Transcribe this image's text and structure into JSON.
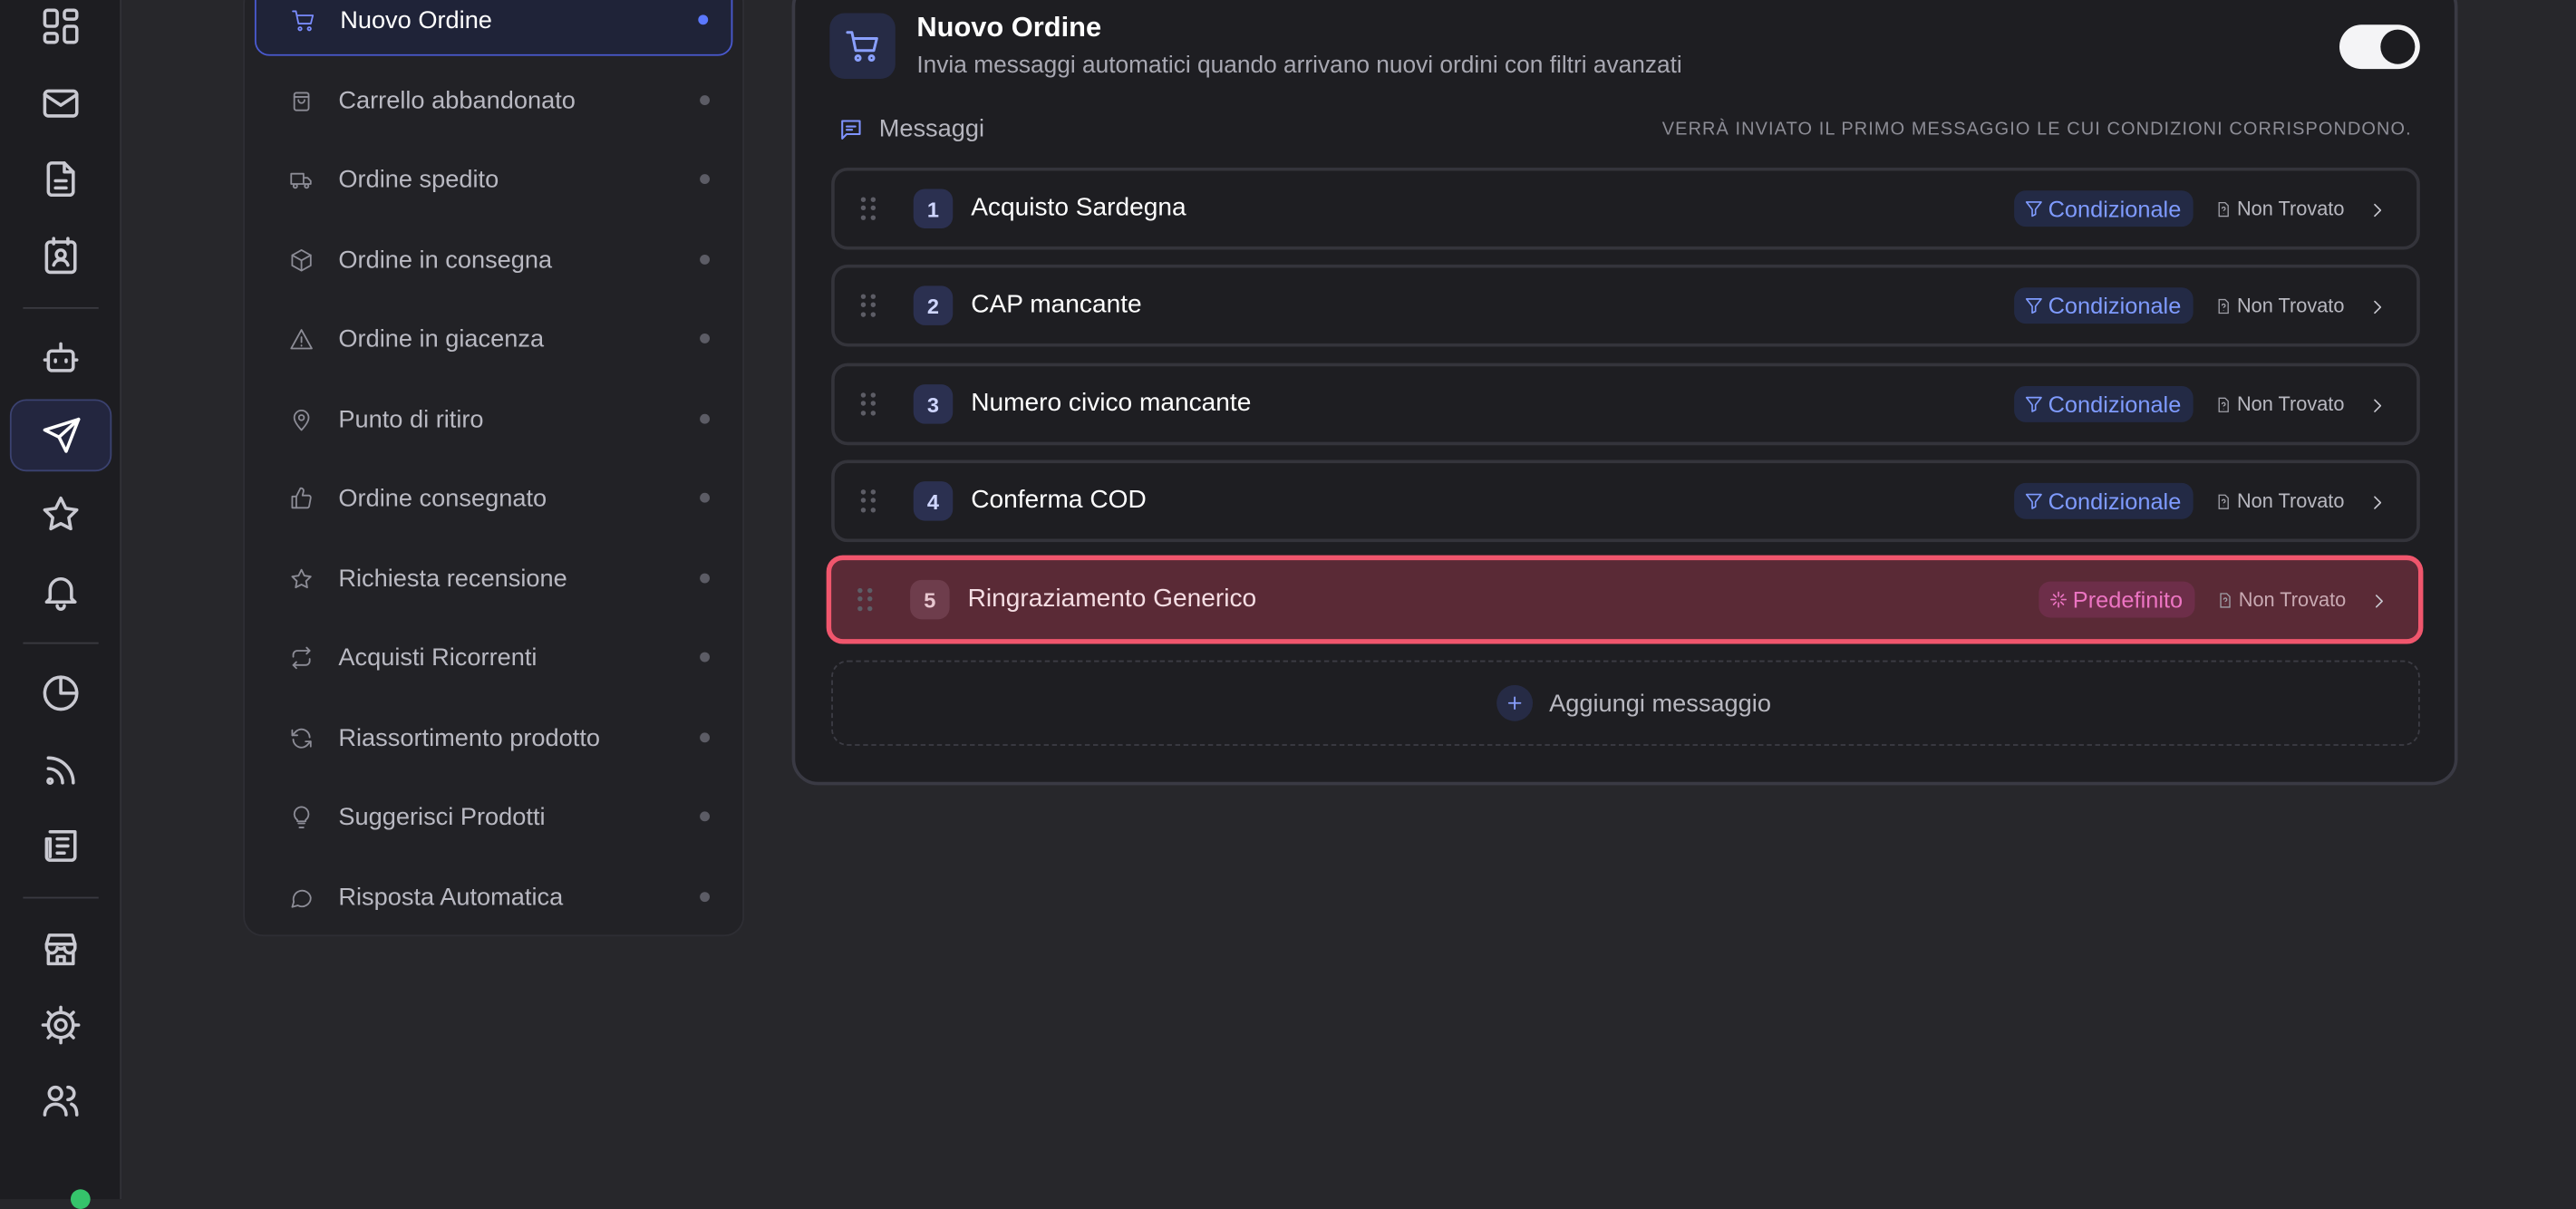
{
  "rail": {
    "items": [
      {
        "icon": "dashboard-icon"
      },
      {
        "icon": "mail-icon"
      },
      {
        "icon": "document-icon"
      },
      {
        "icon": "contact-card-icon"
      },
      {
        "icon": "bot-icon"
      },
      {
        "icon": "send-icon",
        "active": true
      },
      {
        "icon": "star-icon"
      },
      {
        "icon": "bell-icon"
      },
      {
        "icon": "pie-chart-icon"
      },
      {
        "icon": "rss-icon"
      },
      {
        "icon": "newspaper-icon"
      },
      {
        "icon": "store-icon"
      },
      {
        "icon": "settings-icon"
      },
      {
        "icon": "users-icon"
      }
    ]
  },
  "triggers": [
    {
      "label": "Nuovo Ordine",
      "icon": "cart-icon",
      "active": true
    },
    {
      "label": "Carrello abbandonato",
      "icon": "bag-icon"
    },
    {
      "label": "Ordine spedito",
      "icon": "truck-icon"
    },
    {
      "label": "Ordine in consegna",
      "icon": "package-icon"
    },
    {
      "label": "Ordine in giacenza",
      "icon": "warning-icon"
    },
    {
      "label": "Punto di ritiro",
      "icon": "map-pin-icon"
    },
    {
      "label": "Ordine consegnato",
      "icon": "thumbs-up-icon"
    },
    {
      "label": "Richiesta recensione",
      "icon": "star-icon"
    },
    {
      "label": "Acquisti Ricorrenti",
      "icon": "repeat-icon"
    },
    {
      "label": "Riassortimento prodotto",
      "icon": "refresh-icon"
    },
    {
      "label": "Suggerisci Prodotti",
      "icon": "lightbulb-icon"
    },
    {
      "label": "Risposta Automatica",
      "icon": "chat-bubble-icon"
    }
  ],
  "card": {
    "title": "Nuovo Ordine",
    "subtitle": "Invia messaggi automatici quando arrivano nuovi ordini con filtri avanzati",
    "enabled": true,
    "messages_label": "Messaggi",
    "messages_note": "Verrà inviato il primo messaggio le cui condizioni corrispondono."
  },
  "messages": [
    {
      "num": "1",
      "name": "Acquisto Sardegna",
      "badge": "Condizionale",
      "badge_type": "conditional",
      "status": "Non Trovato"
    },
    {
      "num": "2",
      "name": "CAP mancante",
      "badge": "Condizionale",
      "badge_type": "conditional",
      "status": "Non Trovato"
    },
    {
      "num": "3",
      "name": "Numero civico mancante",
      "badge": "Condizionale",
      "badge_type": "conditional",
      "status": "Non Trovato"
    },
    {
      "num": "4",
      "name": "Conferma COD",
      "badge": "Condizionale",
      "badge_type": "conditional",
      "status": "Non Trovato"
    },
    {
      "num": "5",
      "name": "Ringraziamento Generico",
      "badge": "Predefinito",
      "badge_type": "default",
      "status": "Non Trovato",
      "selected": true
    }
  ],
  "add_message_label": "Aggiungi messaggio",
  "colors": {
    "accent": "#5b78ff",
    "selected_border": "#f0566d",
    "selected_bg": "#5a2a36",
    "status_online": "#35c46b"
  }
}
